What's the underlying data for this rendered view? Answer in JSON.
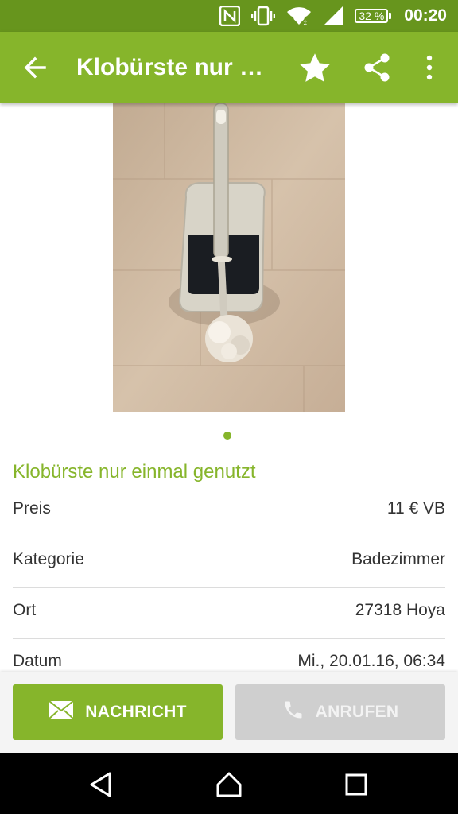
{
  "status_bar": {
    "battery": "32 %",
    "time": "00:20",
    "icons": [
      "nfc-icon",
      "vibrate-icon",
      "wifi-icon",
      "cell-signal-icon",
      "battery-icon"
    ]
  },
  "app_bar": {
    "title": "Klobürste nur ei...",
    "icons": [
      "back-arrow-icon",
      "star-icon",
      "share-icon",
      "more-vert-icon"
    ]
  },
  "listing": {
    "title": "Klobürste nur einmal genutzt",
    "details": [
      {
        "label": "Preis",
        "value": "11 € VB"
      },
      {
        "label": "Kategorie",
        "value": "Badezimmer"
      },
      {
        "label": "Ort",
        "value": "27318 Hoya"
      },
      {
        "label": "Datum",
        "value": "Mi., 20.01.16, 06:34"
      }
    ],
    "image_count": 1
  },
  "actions": {
    "message_label": "NACHRICHT",
    "call_label": "ANRUFEN"
  },
  "colors": {
    "status_bar": "#67951d",
    "app_bar": "#86b52b",
    "accent": "#86b52b",
    "disabled_button": "#cfcfcf"
  }
}
